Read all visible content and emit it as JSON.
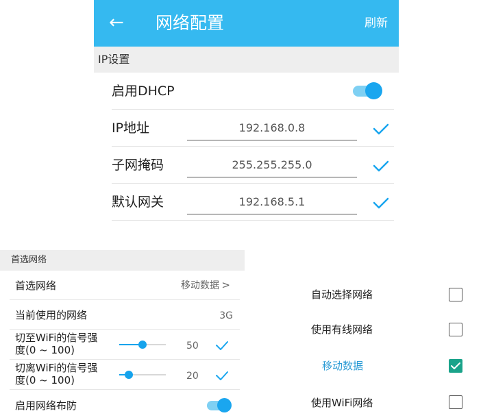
{
  "panel1": {
    "title": "网络配置",
    "refresh_label": "刷新",
    "section_title": "IP设置",
    "dhcp": {
      "label": "启用DHCP",
      "enabled": true
    },
    "fields": [
      {
        "label": "IP地址",
        "value": "192.168.0.8"
      },
      {
        "label": "子网掩码",
        "value": "255.255.255.0"
      },
      {
        "label": "默认网关",
        "value": "192.168.5.1"
      }
    ]
  },
  "panel2": {
    "section_title": "首选网络",
    "preferred": {
      "label": "首选网络",
      "value": "移动数据",
      "arrow": ">"
    },
    "current": {
      "label": "当前使用的网络",
      "value": "3G"
    },
    "switch_to_wifi": {
      "label_line1": "切至WiFi的信号强",
      "label_line2": "度(0 ~ 100)",
      "value": "50",
      "level_fraction": 0.5
    },
    "switch_from_wifi": {
      "label_line1": "切离WiFi的信号强",
      "label_line2": "度(0 ~ 100)",
      "value": "20",
      "level_fraction": 0.2
    },
    "arming": {
      "label": "启用网络布防",
      "enabled": true
    }
  },
  "panel3": {
    "options": [
      {
        "label": "自动选择网络",
        "checked": false
      },
      {
        "label": "使用有线网络",
        "checked": false
      },
      {
        "label": "移动数据",
        "checked": true
      },
      {
        "label": "使用WiFi网络",
        "checked": false
      }
    ]
  },
  "colors": {
    "appbar": "#35b9f0",
    "accent": "#1aa6ef",
    "check_accent": "#1aa38a",
    "active_text": "#2a9bd5"
  }
}
